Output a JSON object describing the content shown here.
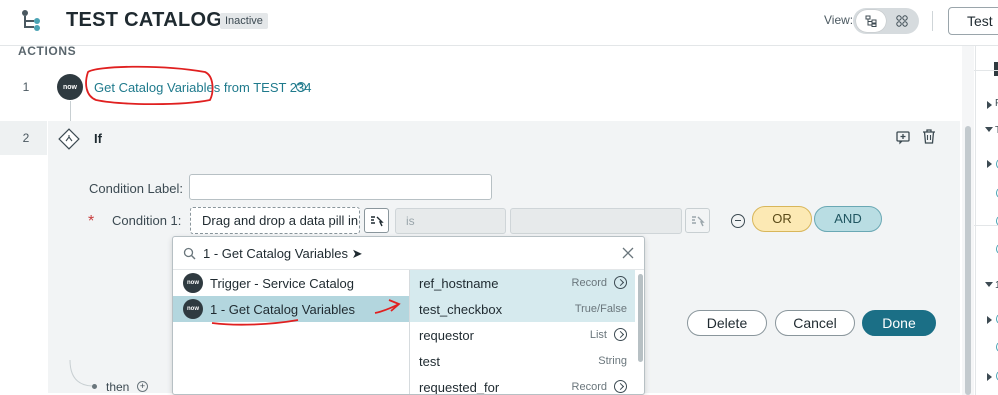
{
  "header": {
    "title": "TEST CATALOG",
    "status": "Inactive",
    "view_label": "View:",
    "test_button": "Test"
  },
  "section_heading": "ACTIONS",
  "step1": {
    "number": "1",
    "badge": "now",
    "link_text": "Get Catalog Variables",
    "suffix_text": " from TEST 234",
    "help": "?"
  },
  "step2": {
    "number": "2",
    "label": "If",
    "condition_label": "Condition Label:",
    "condition_label_value": "",
    "required_star": "*",
    "condition_1": "Condition 1:",
    "pill_placeholder": "Drag and drop a data pill in",
    "operator_value": "is",
    "or_label": "OR",
    "and_label": "AND",
    "delete_label": "Delete",
    "cancel_label": "Cancel",
    "done_label": "Done",
    "then_label": "then"
  },
  "pill_picker": {
    "search_query": "1 - Get Catalog Variables ➤",
    "sources": [
      {
        "badge": "now",
        "label": "Trigger - Service Catalog",
        "selected": false
      },
      {
        "badge": "now",
        "label": "1 - Get Catalog Variables",
        "selected": true
      }
    ],
    "fields": [
      {
        "name": "ref_hostname",
        "type": "Record",
        "has_arrow": true,
        "highlight": true
      },
      {
        "name": "test_checkbox",
        "type": "True/False",
        "has_arrow": false,
        "highlight": true
      },
      {
        "name": "requestor",
        "type": "List",
        "has_arrow": true,
        "highlight": false
      },
      {
        "name": "test",
        "type": "String",
        "has_arrow": false,
        "highlight": false
      },
      {
        "name": "requested_for",
        "type": "Record",
        "has_arrow": true,
        "highlight": false
      }
    ]
  },
  "right_panel": {
    "items": [
      "F",
      "T",
      "1"
    ]
  },
  "colors": {
    "accent": "#1b6f86",
    "link": "#1f7a8c",
    "annotation": "#e02020",
    "or": "#fce9b4",
    "and": "#b9dde3"
  }
}
